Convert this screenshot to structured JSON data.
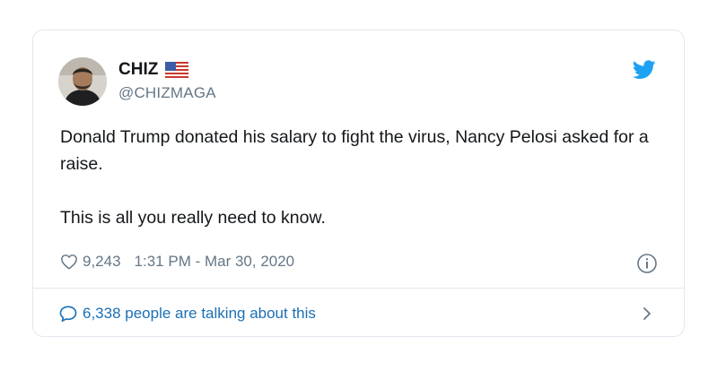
{
  "tweet": {
    "display_name": "CHIZ",
    "handle": "@CHIZMAGA",
    "paragraphs": [
      "Donald Trump donated his salary to fight the virus, Nancy Pelosi asked for a raise.",
      "This is all you really need to know."
    ],
    "likes": "9,243",
    "timestamp": "1:31 PM - Mar 30, 2020",
    "talking": "6,338 people are talking about this"
  },
  "icons": {
    "flag": "us-flag-icon",
    "brand": "twitter-bird-icon",
    "like": "heart-icon",
    "info": "info-icon",
    "reply": "speech-bubble-icon",
    "more": "chevron-right-icon"
  },
  "colors": {
    "brand": "#1da1f2",
    "link": "#1b6fb5",
    "secondary_text": "#657786",
    "border": "#e1e8ed"
  }
}
